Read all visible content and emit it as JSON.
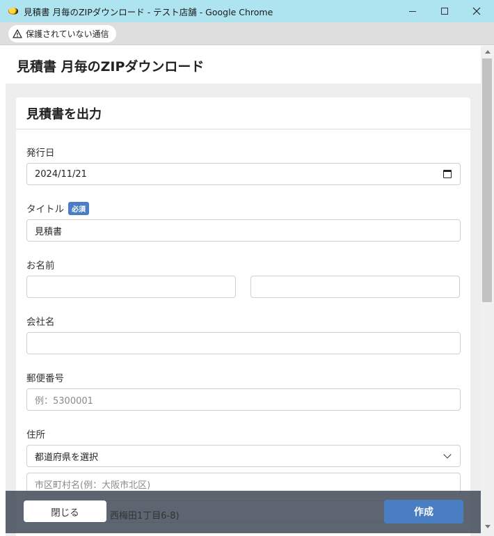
{
  "window": {
    "title": "見積書 月毎のZIPダウンロード - テスト店舗 - Google Chrome",
    "icon": "app-coin-icon"
  },
  "address_bar": {
    "security_text": "保護されていない通信",
    "security_icon": "warning-triangle-icon"
  },
  "page": {
    "title": "見積書 月毎のZIPダウンロード"
  },
  "form": {
    "card_title": "見積書を出力",
    "issue_date": {
      "label": "発行日",
      "value": "2024/11/21"
    },
    "title_field": {
      "label": "タイトル",
      "badge": "必須",
      "value": "見積書"
    },
    "name": {
      "label": "お名前",
      "last_value": "",
      "first_value": ""
    },
    "company": {
      "label": "会社名",
      "value": ""
    },
    "postal": {
      "label": "郵便番号",
      "placeholder": "例：5300001"
    },
    "address": {
      "label": "住所",
      "prefecture_selected": "都道府県を選択",
      "city_placeholder": "市区町村名(例：大阪市北区)",
      "street_placeholder_partial": "西梅田1丁目6-8)"
    }
  },
  "actions": {
    "close_label": "閉じる",
    "create_label": "作成"
  },
  "colors": {
    "titlebar": "#aee4ef",
    "accent": "#4a7ec3",
    "action_bar": "#46505c"
  }
}
